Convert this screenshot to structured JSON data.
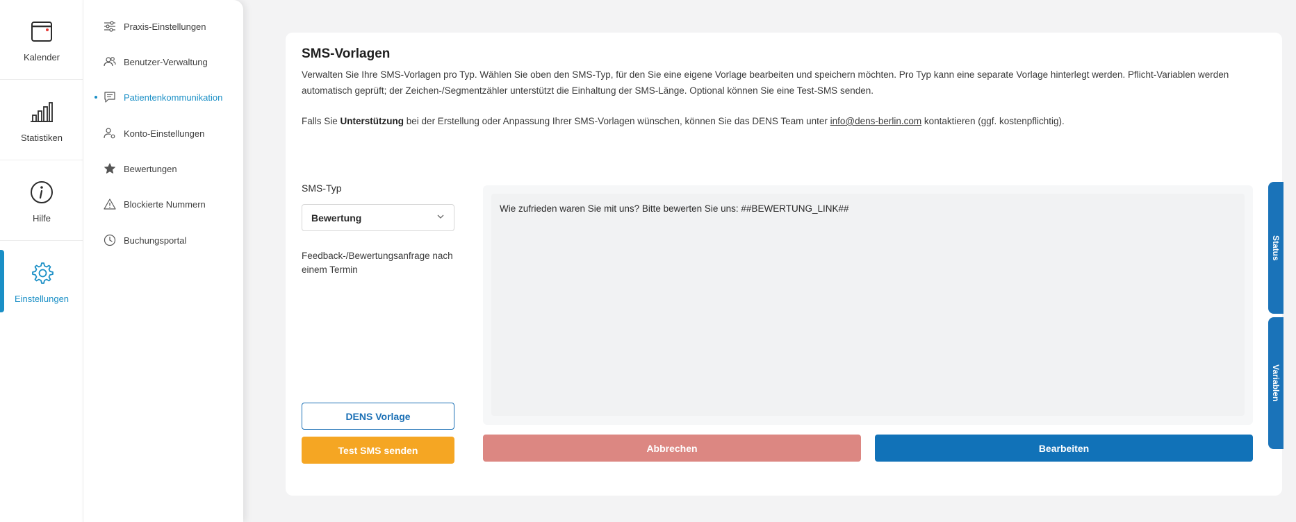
{
  "rail": {
    "items": [
      {
        "label": "Kalender",
        "icon": "calendar-icon"
      },
      {
        "label": "Statistiken",
        "icon": "bar-chart-icon"
      },
      {
        "label": "Hilfe",
        "icon": "info-icon"
      },
      {
        "label": "Einstellungen",
        "icon": "gear-icon",
        "active": true
      }
    ]
  },
  "submenu": {
    "items": [
      {
        "label": "Praxis-Einstellungen",
        "icon": "sliders-icon"
      },
      {
        "label": "Benutzer-Verwaltung",
        "icon": "users-icon"
      },
      {
        "label": "Patientenkommunikation",
        "icon": "chat-icon",
        "active": true
      },
      {
        "label": "Konto-Einstellungen",
        "icon": "user-gear-icon"
      },
      {
        "label": "Bewertungen",
        "icon": "star-icon"
      },
      {
        "label": "Blockierte Nummern",
        "icon": "warning-icon"
      },
      {
        "label": "Buchungsportal",
        "icon": "clock-icon"
      }
    ]
  },
  "card": {
    "title": "SMS-Vorlagen",
    "description": "Verwalten Sie Ihre SMS-Vorlagen pro Typ. Wählen Sie oben den SMS-Typ, für den Sie eine eigene Vorlage bearbeiten und speichern möchten. Pro Typ kann eine separate Vorlage hinterlegt werden. Pflicht-Variablen werden automatisch geprüft; der Zeichen-/Segmentzähler unterstützt die Einhaltung der SMS-Länge. Optional können Sie eine Test-SMS senden.",
    "support_prefix": "Falls Sie ",
    "support_bold": "Unterstützung",
    "support_middle": " bei der Erstellung oder Anpassung Ihrer SMS-Vorlagen wünschen, können Sie das DENS Team unter ",
    "support_email": "info@dens-berlin.com",
    "support_suffix": " kontaktieren (ggf. kostenpflichtig).",
    "sms_type_label": "SMS-Typ",
    "sms_type_value": "Bewertung",
    "sms_type_description": "Feedback-/Bewertungsanfrage nach einem Termin",
    "template_text": "Wie zufrieden waren Sie mit uns? Bitte bewerten Sie uns: ##BEWERTUNG_LINK##",
    "buttons": {
      "dens_template": "DENS Vorlage",
      "test_sms": "Test SMS senden",
      "cancel": "Abbrechen",
      "edit": "Bearbeiten"
    }
  },
  "side_tabs": {
    "status": "Status",
    "variables": "Variablen"
  },
  "colors": {
    "accent": "#1a8fc6",
    "primary_button": "#1172b8",
    "cancel_button": "#dc8782",
    "test_button": "#f5a623"
  }
}
